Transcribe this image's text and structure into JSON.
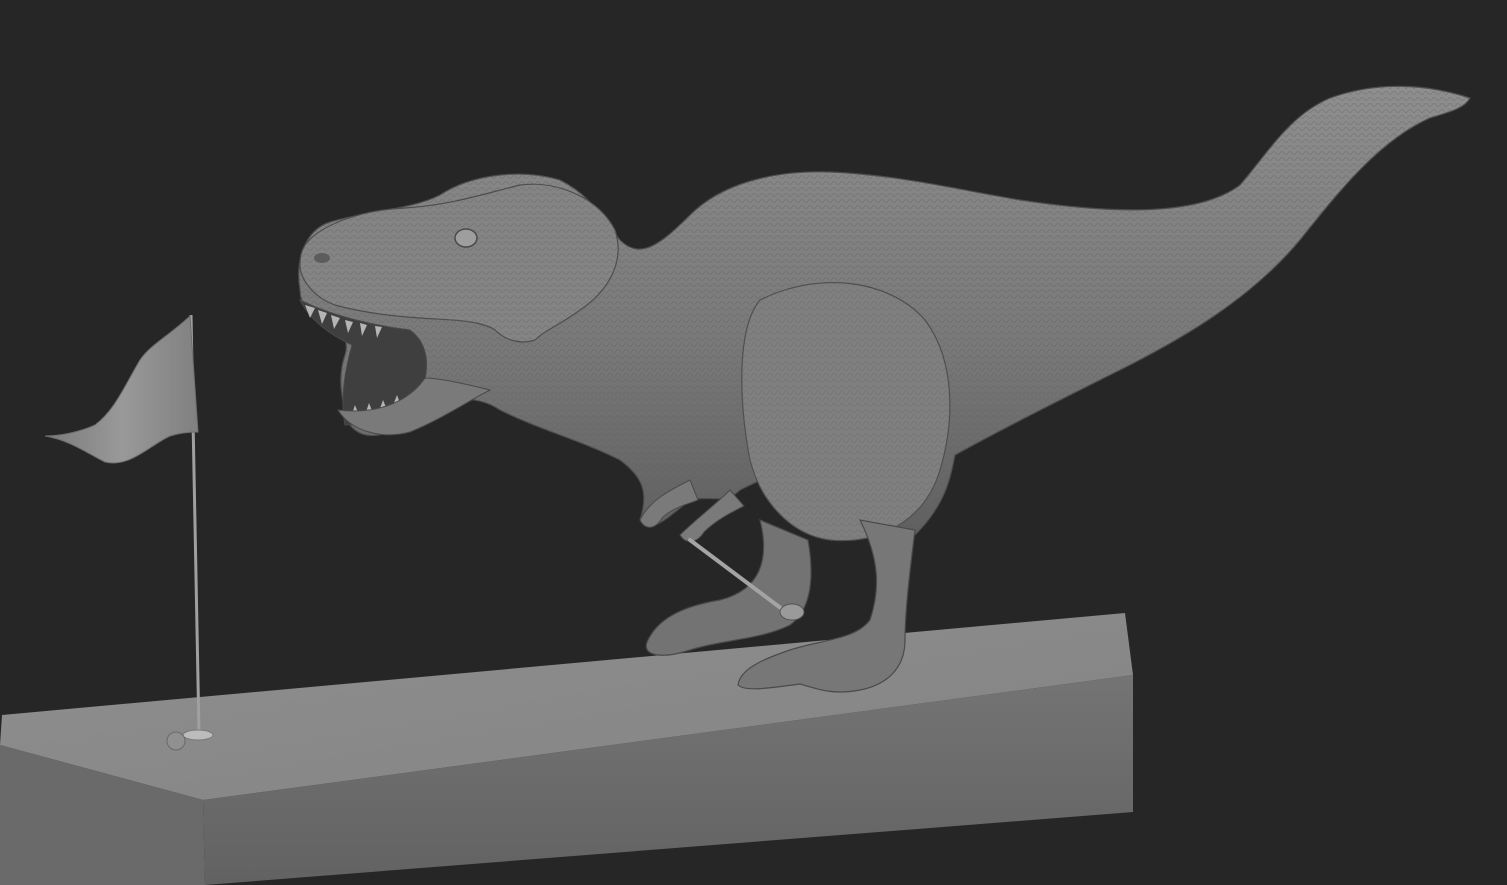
{
  "viewport": {
    "background_color": "#262626",
    "subject": "sculpt-render"
  },
  "scene": {
    "base": {
      "top_color": "#8a8a8a",
      "front_color": "#6b6b6b",
      "side_color": "#5e5e5e"
    },
    "trex": {
      "color": "#7d7d7d",
      "shadow_color": "#5a5a5a",
      "highlight_color": "#9a9a9a"
    },
    "flag": {
      "color": "#8c8c8c",
      "pole_color": "#9a9a9a"
    },
    "golf_ball": {
      "color": "#8e8e8e"
    },
    "golf_club": {
      "color": "#9c9c9c"
    }
  }
}
